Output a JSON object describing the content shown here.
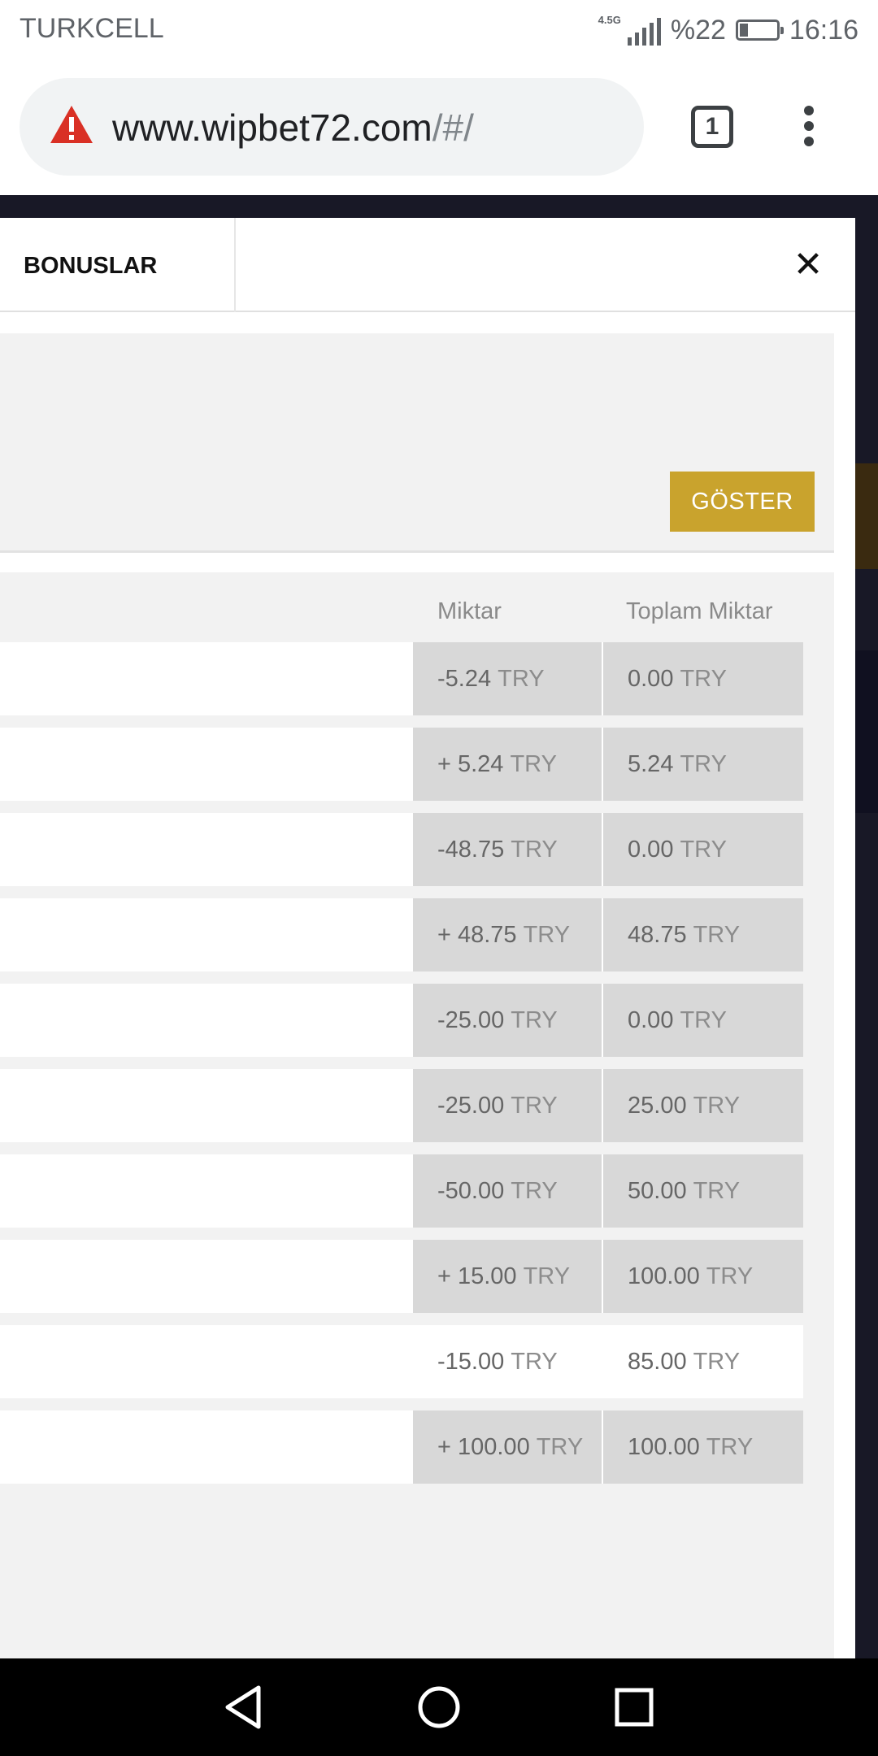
{
  "status_bar": {
    "carrier": "TURKCELL",
    "network": "4.5G",
    "battery": "%22",
    "battery_level": 0.22,
    "time": "16:16"
  },
  "browser": {
    "url_main": "www.wipbet72.com",
    "url_path": "/#/",
    "tab_count": "1",
    "warning_icon": "warning-triangle-icon",
    "menu_icon": "more-vert-icon"
  },
  "panel": {
    "tab_label": "BONUSLAR",
    "close_icon": "close-icon",
    "show_button": "GÖSTER",
    "accent_color": "#c9a32d",
    "columns": {
      "amount": "Miktar",
      "total": "Toplam Miktar"
    },
    "rows": [
      {
        "amount": "-5.24",
        "amount_cur": "TRY",
        "total": "0.00",
        "total_cur": "TRY"
      },
      {
        "amount": "+ 5.24",
        "amount_cur": "TRY",
        "total": "5.24",
        "total_cur": "TRY"
      },
      {
        "amount": "-48.75",
        "amount_cur": "TRY",
        "total": "0.00",
        "total_cur": "TRY"
      },
      {
        "amount": "+ 48.75",
        "amount_cur": "TRY",
        "total": "48.75",
        "total_cur": "TRY"
      },
      {
        "amount": "-25.00",
        "amount_cur": "TRY",
        "total": "0.00",
        "total_cur": "TRY"
      },
      {
        "amount": "-25.00",
        "amount_cur": "TRY",
        "total": "25.00",
        "total_cur": "TRY"
      },
      {
        "amount": "-50.00",
        "amount_cur": "TRY",
        "total": "50.00",
        "total_cur": "TRY"
      },
      {
        "amount": "+ 15.00",
        "amount_cur": "TRY",
        "total": "100.00",
        "total_cur": "TRY"
      },
      {
        "amount": "-15.00",
        "amount_cur": "TRY",
        "total": "85.00",
        "total_cur": "TRY"
      },
      {
        "amount": "+ 100.00",
        "amount_cur": "TRY",
        "total": "100.00",
        "total_cur": "TRY"
      }
    ]
  },
  "nav_bar": {
    "back_icon": "back-triangle-icon",
    "home_icon": "home-circle-icon",
    "recents_icon": "recents-square-icon"
  }
}
